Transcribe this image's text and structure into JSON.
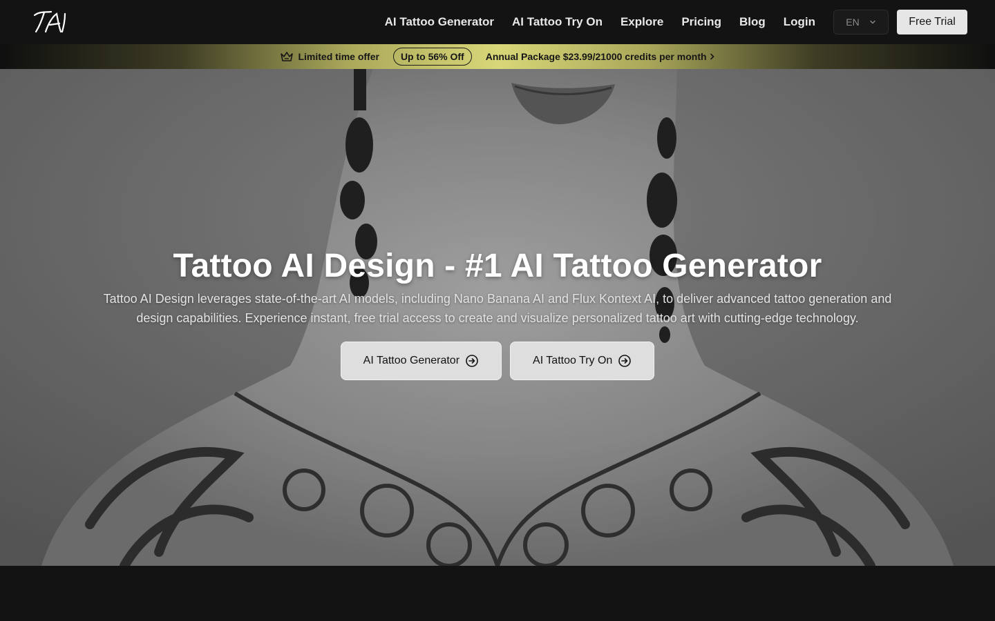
{
  "nav": {
    "logo_text": "TAI",
    "links": [
      "AI Tattoo Generator",
      "AI Tattoo Try On",
      "Explore",
      "Pricing",
      "Blog",
      "Login"
    ],
    "language": "EN",
    "free_trial_label": "Free Trial"
  },
  "offer": {
    "label": "Limited time offer",
    "discount": "Up to 56% Off",
    "package": "Annual Package $23.99/21000 credits per month"
  },
  "hero": {
    "title": "Tattoo AI Design - #1 AI Tattoo Generator",
    "subtitle": "Tattoo AI Design leverages state-of-the-art AI models, including Nano Banana AI and Flux Kontext AI, to deliver advanced tattoo generation and design capabilities. Experience instant, free trial access to create and visualize personalized tattoo art with cutting-edge technology.",
    "buttons": [
      "AI Tattoo Generator",
      "AI Tattoo Try On"
    ]
  },
  "colors": {
    "nav_bg": "#131313",
    "offer_gold": "#d8d778",
    "button_bg": "#dedede"
  }
}
